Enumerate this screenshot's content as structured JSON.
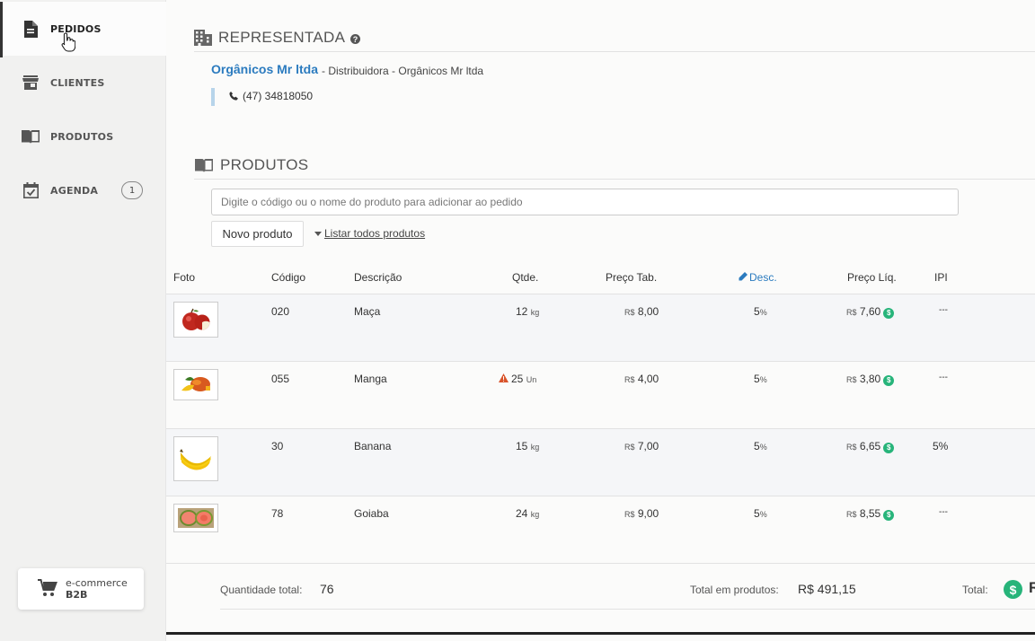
{
  "sidebar": {
    "items": [
      {
        "label": "PEDIDOS",
        "icon": "document-icon",
        "active": true
      },
      {
        "label": "CLIENTES",
        "icon": "store-icon"
      },
      {
        "label": "PRODUTOS",
        "icon": "book-icon"
      },
      {
        "label": "AGENDA",
        "icon": "calendar-check-icon",
        "badge": "1"
      }
    ],
    "ecommerce": {
      "line1": "e-commerce",
      "line2": "B2B"
    }
  },
  "representada": {
    "title": "REPRESENTADA",
    "name": "Orgânicos Mr ltda",
    "subtitle": "- Distribuidora - Orgânicos Mr ltda",
    "phone": "(47) 34818050"
  },
  "produtos": {
    "title": "PRODUTOS",
    "search_placeholder": "Digite o código ou o nome do produto para adicionar ao pedido",
    "novo_button": "Novo produto",
    "listar_link": "Listar todos produtos"
  },
  "table": {
    "headers": {
      "foto": "Foto",
      "codigo": "Código",
      "descricao": "Descrição",
      "qtde": "Qtde.",
      "preco_tab": "Preço Tab.",
      "desc": "Desc.",
      "preco_liq": "Preço Líq.",
      "ipi": "IPI"
    },
    "rows": [
      {
        "codigo": "020",
        "descricao": "Maça",
        "qtde": "12",
        "unit": "kg",
        "preco_tab_cur": "R$",
        "preco_tab": "8,00",
        "desc": "5",
        "desc_unit": "%",
        "preco_liq_cur": "R$",
        "preco_liq": "7,60",
        "ipi": "---",
        "fruit": "apple"
      },
      {
        "codigo": "055",
        "descricao": "Manga",
        "qtde": "25",
        "unit": "Un",
        "warning": true,
        "preco_tab_cur": "R$",
        "preco_tab": "4,00",
        "desc": "5",
        "desc_unit": "%",
        "preco_liq_cur": "R$",
        "preco_liq": "3,80",
        "ipi": "---",
        "fruit": "mango"
      },
      {
        "codigo": "30",
        "descricao": "Banana",
        "qtde": "15",
        "unit": "kg",
        "preco_tab_cur": "R$",
        "preco_tab": "7,00",
        "desc": "5",
        "desc_unit": "%",
        "preco_liq_cur": "R$",
        "preco_liq": "6,65",
        "ipi": "5%",
        "fruit": "banana"
      },
      {
        "codigo": "78",
        "descricao": "Goiaba",
        "qtde": "24",
        "unit": "kg",
        "preco_tab_cur": "R$",
        "preco_tab": "9,00",
        "desc": "5",
        "desc_unit": "%",
        "preco_liq_cur": "R$",
        "preco_liq": "8,55",
        "ipi": "---",
        "fruit": "guava"
      }
    ]
  },
  "footer": {
    "qtd_label": "Quantidade total:",
    "qtd_value": "76",
    "total_produtos_label": "Total em produtos:",
    "total_produtos_value": "R$ 491,15",
    "total_label": "Total:",
    "total_value_partial": "R"
  },
  "colors": {
    "accent": "#2b7bbf",
    "money": "#27b47a",
    "warning": "#d9542b"
  }
}
